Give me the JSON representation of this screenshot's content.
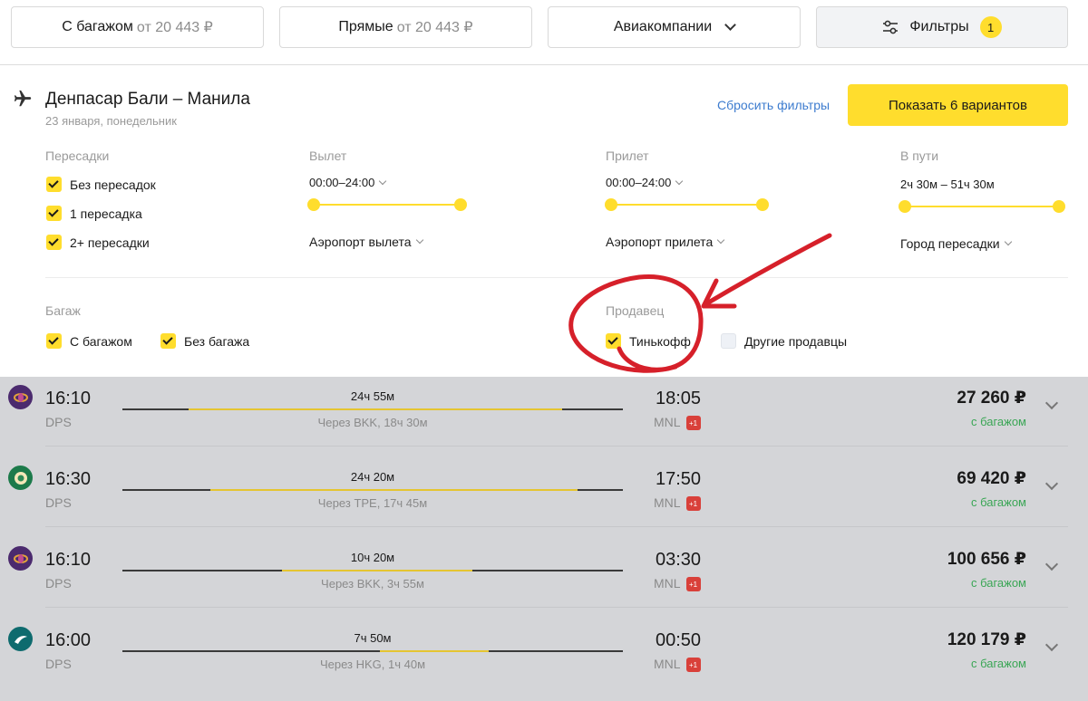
{
  "topbar": {
    "baggage": {
      "label": "С багажом",
      "price": "от 20 443 ₽"
    },
    "direct": {
      "label": "Прямые",
      "price": "от 20 443 ₽"
    },
    "airlines": {
      "label": "Авиакомпании"
    },
    "filters": {
      "label": "Фильтры",
      "count": "1"
    }
  },
  "panel": {
    "route": "Денпасар Бали – Манила",
    "date": "23 января, понедельник",
    "reset": "Сбросить фильтры",
    "show": "Показать 6 вариантов",
    "transfers": {
      "title": "Пересадки",
      "options": [
        "Без пересадок",
        "1 пересадка",
        "2+ пересадки"
      ]
    },
    "departure": {
      "title": "Вылет",
      "range": "00:00–24:00",
      "airport": "Аэропорт вылета"
    },
    "arrival": {
      "title": "Прилет",
      "range": "00:00–24:00",
      "airport": "Аэропорт прилета"
    },
    "travel": {
      "title": "В пути",
      "range": "2ч 30м – 51ч 30м",
      "city": "Город пересадки"
    },
    "baggage": {
      "title": "Багаж",
      "options": [
        "С багажом",
        "Без багажа"
      ]
    },
    "seller": {
      "title": "Продавец",
      "options": [
        "Тинькофф",
        "Другие продавцы"
      ]
    }
  },
  "icons": {
    "plane": "airplane-icon",
    "filters": "sliders-icon",
    "chevron": "chevron-down-icon"
  },
  "colors": {
    "accent": "#ffdd2d",
    "link": "#3d7ccf",
    "baggage_green": "#3aa655",
    "next_day": "#d9403a",
    "annotation": "#d6202a"
  },
  "flights": [
    {
      "dep_time": "16:10",
      "dep_code": "DPS",
      "duration": "24ч 55м",
      "via": "Через BKK, 18ч 30м",
      "arr_time": "18:05",
      "arr_code": "MNL",
      "next_day": "+1",
      "price": "27 260 ₽",
      "baggage": "с багажом",
      "airline_icon": "thai-airways-logo-icon"
    },
    {
      "dep_time": "16:30",
      "dep_code": "DPS",
      "duration": "24ч 20м",
      "via": "Через TPE, 17ч 45м",
      "arr_time": "17:50",
      "arr_code": "MNL",
      "next_day": "+1",
      "price": "69 420 ₽",
      "baggage": "с багажом",
      "airline_icon": "eva-air-logo-icon"
    },
    {
      "dep_time": "16:10",
      "dep_code": "DPS",
      "duration": "10ч 20м",
      "via": "Через BKK, 3ч 55м",
      "arr_time": "03:30",
      "arr_code": "MNL",
      "next_day": "+1",
      "price": "100 656 ₽",
      "baggage": "с багажом",
      "airline_icon": "thai-airways-logo-icon"
    },
    {
      "dep_time": "16:00",
      "dep_code": "DPS",
      "duration": "7ч 50м",
      "via": "Через HKG, 1ч 40м",
      "arr_time": "00:50",
      "arr_code": "MNL",
      "next_day": "+1",
      "price": "120 179 ₽",
      "baggage": "с багажом",
      "airline_icon": "cathay-pacific-logo-icon"
    }
  ]
}
